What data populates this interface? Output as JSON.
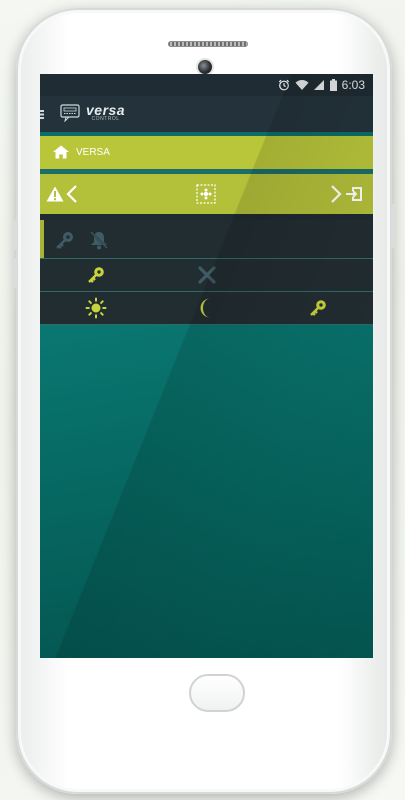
{
  "status_bar": {
    "time": "6:03"
  },
  "app_bar": {
    "logo_text": "versa",
    "logo_subtext": "CONTROL"
  },
  "header": {
    "title": "VERSA"
  },
  "colors": {
    "accent_lime": "#b9c63a",
    "dark_panel": "#222d32",
    "teal_background": "#0a7a73",
    "icon_yellow": "#c9d43c",
    "icon_muted": "#3f5c66"
  },
  "control_bar": {
    "icons": [
      "alert-icon",
      "chevron-left-icon",
      "zone-selector-icon",
      "chevron-right-icon",
      "exit-icon"
    ]
  },
  "rows": {
    "info_icons": [
      "key-icon",
      "bell-icon"
    ],
    "row1": [
      "key-icon",
      "close-icon"
    ],
    "row2": [
      "sun-icon",
      "moon-icon",
      "key-icon"
    ]
  }
}
